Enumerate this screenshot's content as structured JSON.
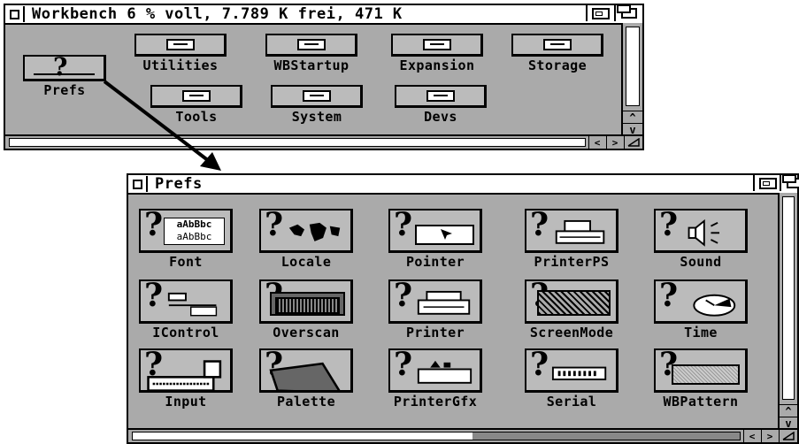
{
  "workbench_window": {
    "title": "Workbench  6 % voll, 7.789 K frei, 471 K",
    "drawers": [
      "Utilities",
      "WBStartup",
      "Expansion",
      "Storage",
      "Tools",
      "System",
      "Devs"
    ],
    "prefs_label": "Prefs"
  },
  "prefs_window": {
    "title": "Prefs",
    "icons": [
      {
        "label": "Font",
        "icon": "font-icon"
      },
      {
        "label": "Locale",
        "icon": "world-map-icon"
      },
      {
        "label": "Pointer",
        "icon": "pointer-icon"
      },
      {
        "label": "PrinterPS",
        "icon": "printer-ps-icon"
      },
      {
        "label": "Sound",
        "icon": "speaker-icon"
      },
      {
        "label": "IControl",
        "icon": "icontrol-icon"
      },
      {
        "label": "Overscan",
        "icon": "monitor-icon"
      },
      {
        "label": "Printer",
        "icon": "printer-icon"
      },
      {
        "label": "ScreenMode",
        "icon": "screenmode-icon"
      },
      {
        "label": "Time",
        "icon": "clock-icon"
      },
      {
        "label": "Input",
        "icon": "keyboard-mouse-icon"
      },
      {
        "label": "Palette",
        "icon": "palette-icon"
      },
      {
        "label": "PrinterGfx",
        "icon": "printer-gfx-icon"
      },
      {
        "label": "Serial",
        "icon": "serial-port-icon"
      },
      {
        "label": "WBPattern",
        "icon": "pattern-icon"
      }
    ],
    "font_sample_1": "aAbBbc",
    "font_sample_2": "aAbBbc"
  },
  "scroll_glyphs": {
    "up": "^",
    "down": "v",
    "left": "<",
    "right": ">"
  }
}
